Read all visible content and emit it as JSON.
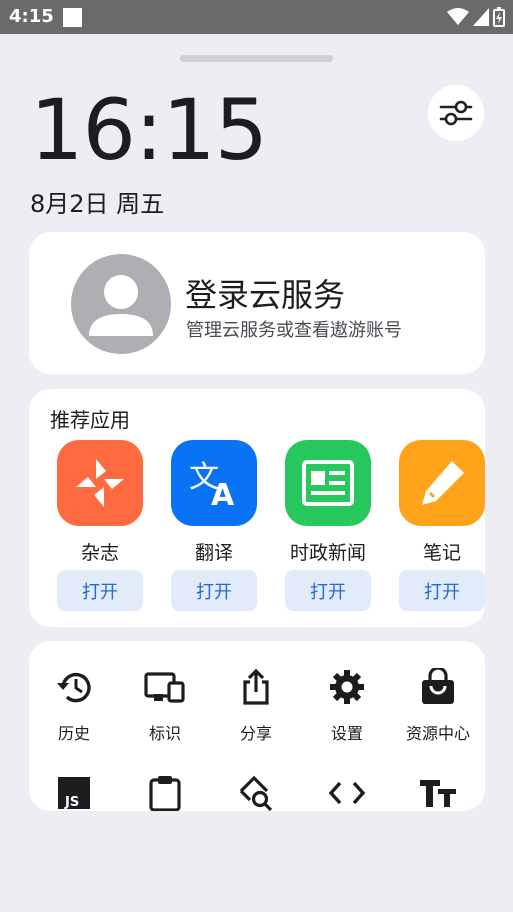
{
  "status_bar": {
    "time": "4:15"
  },
  "clock": {
    "time": "16:15",
    "date": "8月2日 周五"
  },
  "account": {
    "title": "登录云服务",
    "subtitle": "管理云服务或查看遨游账号"
  },
  "recommended": {
    "title": "推荐应用",
    "apps": [
      {
        "name": "杂志",
        "open_label": "打开",
        "icon": "pinwheel-icon",
        "color": "#ff6a40"
      },
      {
        "name": "翻译",
        "open_label": "打开",
        "icon": "translate-icon",
        "color": "#0a72f5"
      },
      {
        "name": "时政新闻",
        "open_label": "打开",
        "icon": "newspaper-icon",
        "color": "#27c95f"
      },
      {
        "name": "笔记",
        "open_label": "打开",
        "icon": "pencil-icon",
        "color": "#ffa31a"
      }
    ]
  },
  "tools": {
    "row1": [
      {
        "label": "历史",
        "icon": "history-icon"
      },
      {
        "label": "标识",
        "icon": "devices-icon"
      },
      {
        "label": "分享",
        "icon": "share-icon"
      },
      {
        "label": "设置",
        "icon": "gear-icon"
      },
      {
        "label": "资源中心",
        "icon": "shopping-bag-icon"
      }
    ],
    "row2": [
      {
        "icon": "javascript-icon"
      },
      {
        "icon": "clipboard-icon"
      },
      {
        "icon": "page-search-icon"
      },
      {
        "icon": "code-icon"
      },
      {
        "icon": "text-size-icon"
      }
    ]
  }
}
